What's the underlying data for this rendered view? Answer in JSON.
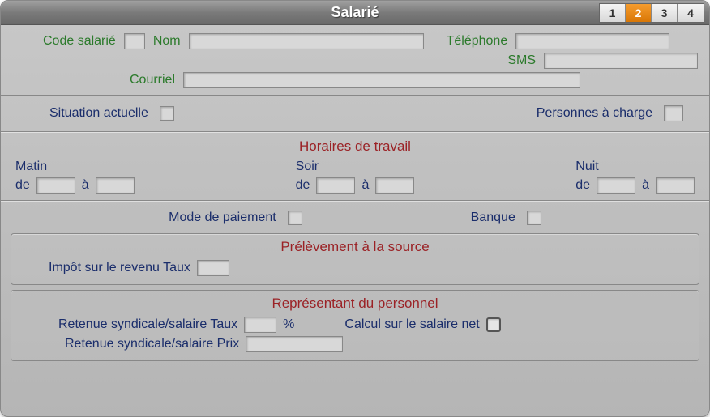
{
  "title": "Salarié",
  "tabs": [
    "1",
    "2",
    "3",
    "4"
  ],
  "active_tab_index": 1,
  "fields": {
    "code_salarie": "Code salarié",
    "nom": "Nom",
    "telephone": "Téléphone",
    "sms": "SMS",
    "courriel": "Courriel",
    "situation_actuelle": "Situation actuelle",
    "personnes_a_charge": "Personnes à charge",
    "mode_de_paiement": "Mode de paiement",
    "banque": "Banque",
    "impot_taux": "Impôt sur le revenu Taux",
    "retenue_taux": "Retenue syndicale/salaire Taux",
    "retenue_prix": "Retenue syndicale/salaire Prix",
    "calcul_net": "Calcul sur le salaire net",
    "percent": "%"
  },
  "sections": {
    "horaires": "Horaires de travail",
    "prelevement": "Prélèvement à la source",
    "representant": "Représentant du personnel"
  },
  "schedule": {
    "matin": "Matin",
    "soir": "Soir",
    "nuit": "Nuit",
    "de": "de",
    "a": "à"
  },
  "values": {
    "code_salarie": "",
    "nom": "",
    "telephone": "",
    "sms": "",
    "courriel": "",
    "matin_de": "",
    "matin_a": "",
    "soir_de": "",
    "soir_a": "",
    "nuit_de": "",
    "nuit_a": "",
    "impot_taux": "",
    "retenue_taux": "",
    "retenue_prix": ""
  }
}
